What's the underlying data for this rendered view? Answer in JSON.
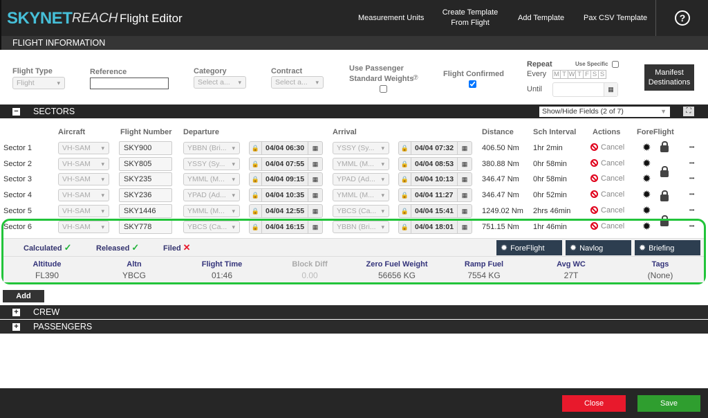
{
  "header": {
    "logo_bold": "SKYNET",
    "logo_italic": "REACH",
    "title": "Flight Editor",
    "nav": [
      "Measurement Units",
      "Create Template From Flight",
      "Add Template",
      "Pax CSV Template"
    ],
    "help": "?"
  },
  "flight_info": {
    "title": "FLIGHT INFORMATION",
    "flight_type_label": "Flight Type",
    "flight_type_value": "Flight",
    "reference_label": "Reference",
    "reference_value": "",
    "category_label": "Category",
    "category_value": "Select a...",
    "contract_label": "Contract",
    "contract_value": "Select a...",
    "std_weights_label_1": "Use Passenger",
    "std_weights_label_2": "Standard Weights",
    "std_weights_checked": false,
    "confirmed_label": "Flight Confirmed",
    "confirmed_checked": true,
    "repeat_label": "Repeat",
    "use_specific_label": "Use Specific",
    "every_label": "Every",
    "days": [
      "M",
      "T",
      "W",
      "T",
      "F",
      "S",
      "S"
    ],
    "until_label": "Until",
    "until_value": "",
    "manifest_button": "Manifest Destinations"
  },
  "sectors": {
    "title": "SECTORS",
    "show_hide": "Show/Hide Fields (2 of 7)",
    "columns": {
      "aircraft": "Aircraft",
      "flight_number": "Flight Number",
      "departure": "Departure",
      "arrival": "Arrival",
      "distance": "Distance",
      "interval": "Sch Interval",
      "actions": "Actions",
      "foreflight": "ForeFlight"
    },
    "rows": [
      {
        "label": "Sector 1",
        "aircraft": "VH-SAM",
        "flight": "SKY900",
        "dep": "YBBN (Bri...",
        "dep_time": "04/04 06:30",
        "arr": "YSSY (Sy...",
        "arr_time": "04/04 07:32",
        "distance": "406.50 Nm",
        "interval": "1hr 2min",
        "action": "Cancel"
      },
      {
        "label": "Sector 2",
        "aircraft": "VH-SAM",
        "flight": "SKY805",
        "dep": "YSSY (Sy...",
        "dep_time": "04/04 07:55",
        "arr": "YMML (M...",
        "arr_time": "04/04 08:53",
        "distance": "380.88 Nm",
        "interval": "0hr 58min",
        "action": "Cancel"
      },
      {
        "label": "Sector 3",
        "aircraft": "VH-SAM",
        "flight": "SKY235",
        "dep": "YMML (M...",
        "dep_time": "04/04 09:15",
        "arr": "YPAD (Ad...",
        "arr_time": "04/04 10:13",
        "distance": "346.47 Nm",
        "interval": "0hr 58min",
        "action": "Cancel"
      },
      {
        "label": "Sector 4",
        "aircraft": "VH-SAM",
        "flight": "SKY236",
        "dep": "YPAD (Ad...",
        "dep_time": "04/04 10:35",
        "arr": "YMML (M...",
        "arr_time": "04/04 11:27",
        "distance": "346.47 Nm",
        "interval": "0hr 52min",
        "action": "Cancel"
      },
      {
        "label": "Sector 5",
        "aircraft": "VH-SAM",
        "flight": "SKY1446",
        "dep": "YMML (M...",
        "dep_time": "04/04 12:55",
        "arr": "YBCS (Ca...",
        "arr_time": "04/04 15:41",
        "distance": "1249.02 Nm",
        "interval": "2hrs 46min",
        "action": "Cancel"
      },
      {
        "label": "Sector 6",
        "aircraft": "VH-SAM",
        "flight": "SKY778",
        "dep": "YBCS (Ca...",
        "dep_time": "04/04 16:15",
        "arr": "YBBN (Bri...",
        "arr_time": "04/04 18:01",
        "distance": "751.15 Nm",
        "interval": "1hr 46min",
        "action": "Cancel"
      }
    ],
    "detail": {
      "status": [
        {
          "label": "Calculated",
          "ok": true
        },
        {
          "label": "Released",
          "ok": true
        },
        {
          "label": "Filed",
          "ok": false
        }
      ],
      "buttons": [
        "ForeFlight",
        "Navlog",
        "Briefing"
      ],
      "metrics": [
        {
          "label": "Altitude",
          "value": "FL390"
        },
        {
          "label": "Altn",
          "value": "YBCG"
        },
        {
          "label": "Flight Time",
          "value": "01:46"
        },
        {
          "label": "Block Diff",
          "value": "0.00",
          "muted": true
        },
        {
          "label": "Zero Fuel Weight",
          "value": "56656 KG"
        },
        {
          "label": "Ramp Fuel",
          "value": "7554 KG"
        },
        {
          "label": "Avg WC",
          "value": "27T"
        },
        {
          "label": "Tags",
          "value": "(None)"
        }
      ]
    },
    "add_button": "Add"
  },
  "crew": {
    "title": "CREW"
  },
  "passengers": {
    "title": "PASSENGERS"
  },
  "footer": {
    "close": "Close",
    "save": "Save"
  },
  "colors": {
    "accent": "#46bfd8",
    "highlight": "#22c43a",
    "close": "#e8192c",
    "save": "#2f9e2f"
  }
}
